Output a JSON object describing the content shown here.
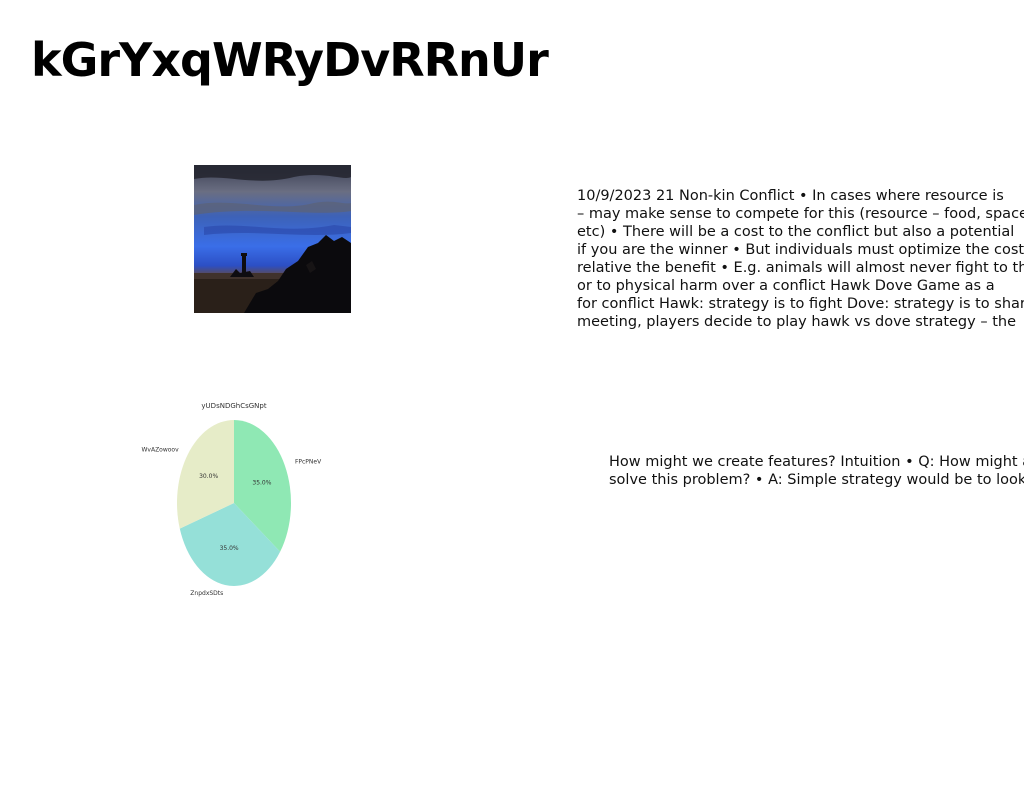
{
  "title": "kGrYxqWRyDvRRnUr",
  "image": {
    "description_icon": "landscape-photo-icon"
  },
  "chart_data": {
    "type": "pie",
    "title": "yUDsNDGhCsGNpt",
    "categories": [
      "FPcPNeV",
      "ZnpdxSDts",
      "WvAZowoov"
    ],
    "values": [
      35.0,
      35.0,
      30.0
    ],
    "value_labels": [
      "35.0%",
      "35.0%",
      "30.0%"
    ],
    "colors": [
      "#8fe8b4",
      "#95e0d8",
      "#e6ecc8"
    ]
  },
  "text_block_1": {
    "lines": [
      "10/9/2023 21 Non-kin Conflict • In cases where resource is",
      "– may make sense to compete for this (resource – food, space,",
      "etc) • There will be a cost to the conflict but also a potential",
      "if you are the winner • But individuals must optimize the cost",
      "relative the benefit • E.g. animals will almost never fight to the",
      "or to physical harm over a conflict Hawk Dove Game as a",
      "for conflict Hawk: strategy is to fight Dove: strategy is to share",
      "meeting, players decide to play hawk vs dove strategy – the"
    ]
  },
  "text_block_2": {
    "lines": [
      "How might we create features? Intuition • Q: How might a",
      "solve this problem? • A: Simple strategy would be to look"
    ]
  }
}
